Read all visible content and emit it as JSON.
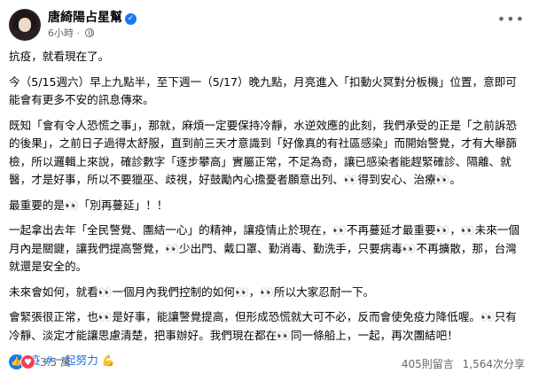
{
  "post": {
    "author": "唐綺陽占星幫",
    "time": "6小時",
    "separator": "·",
    "paragraphs": [
      "抗疫，就看現在了。",
      "今（5/15週六）早上九點半，至下週一（5/17）晚九點，月亮進入「扣動火冥對分板機」位置，意即可能會有更多不安的訊息傳來。",
      "既知「會有令人恐慌之事」，那就，麻煩一定要保持冷靜，水逆效應的此刻，我們承受的正是「之前訴恐的後果」，之前日子過得太舒服，直到前三天才意識到「好像真的有社區感染」而開始警覺，才有大舉篩檢，所以邏輯上來說，確診數字「逐步攀高」實屬正常，不足為奇，讓已感染者能趕緊確診、隔離、就醫，才是好事，所以不要獵巫、歧視，好鼓勵內心擔憂者願意出列、👀得到安心、治療👀。",
      "最重要的是👀「別再蔓延」！！",
      "一起拿出去年「全民警覺、團結一心」的精神，讓疫情止於現在，👀不再蔓延才最重要👀，👀未來一個月內是關鍵，讓我們提高警覺，👀少出門、戴口罩、勤消毒、勤洗手，只要病毒👀不再擴散，那，台灣就還是安全的。",
      "未來會如何，就看👀一個月內我們控制的如何👀，👀所以大家忍耐一下。",
      "會緊張很正常，也👀是好事，能讓警覺提高，但形成恐慌就大可不必，反而會使免疫力降低喔。👀只有冷靜、淡定才能讓思慮清楚，把事辦好。我們現在都在👀同一條船上，一起，再次團結吧！"
    ],
    "hashtags": [
      "#抗疫",
      "#一起努力"
    ],
    "hashtag_emoji": "💪"
  },
  "footer": {
    "reaction_count": "3.5 萬",
    "comments": "405則留言",
    "shares": "1,564次分享"
  },
  "icons": {
    "verified": "verified-badge-icon",
    "privacy": "globe-icon",
    "more": "more-options-icon",
    "like": "like-icon",
    "love": "heart-icon"
  }
}
